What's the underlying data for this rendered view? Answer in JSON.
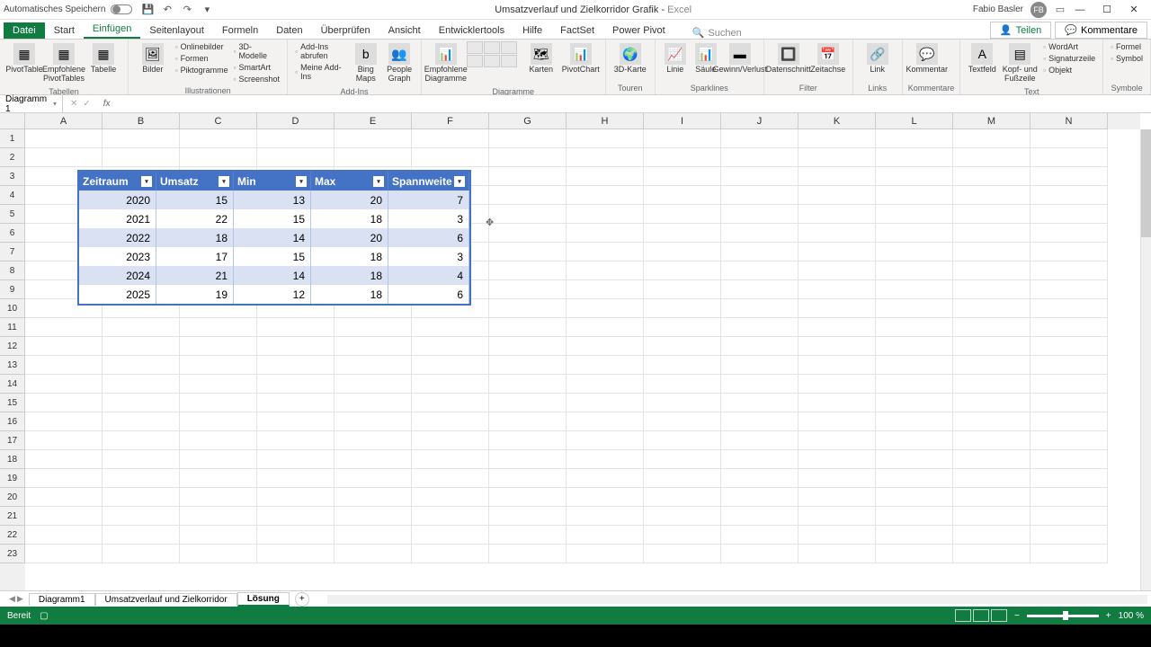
{
  "titlebar": {
    "autosave": "Automatisches Speichern",
    "doc_name": "Umsatzverlauf und Zielkorridor Grafik",
    "app_name": "Excel",
    "user": "Fabio Basler",
    "user_initials": "FB"
  },
  "tabs": {
    "file": "Datei",
    "items": [
      "Start",
      "Einfügen",
      "Seitenlayout",
      "Formeln",
      "Daten",
      "Überprüfen",
      "Ansicht",
      "Entwicklertools",
      "Hilfe",
      "FactSet",
      "Power Pivot"
    ],
    "active": "Einfügen",
    "search_placeholder": "Suchen",
    "share": "Teilen",
    "comments": "Kommentare"
  },
  "ribbon": {
    "groups": {
      "tabellen": {
        "label": "Tabellen",
        "pivot": "PivotTable",
        "empf": "Empfohlene PivotTables",
        "table": "Tabelle"
      },
      "illustrationen": {
        "label": "Illustrationen",
        "bilder": "Bilder",
        "online": "Onlinebilder",
        "formen": "Formen",
        "smartart": "SmartArt",
        "pikto": "Piktogramme",
        "model3d": "3D-Modelle",
        "screenshot": "Screenshot"
      },
      "addins": {
        "label": "Add-Ins",
        "abrufen": "Add-Ins abrufen",
        "meine": "Meine Add-Ins",
        "bing": "Bing Maps",
        "people": "People Graph"
      },
      "diagramme": {
        "label": "Diagramme",
        "empf": "Empfohlene Diagramme",
        "karten": "Karten",
        "pivot": "PivotChart"
      },
      "touren": {
        "label": "Touren",
        "karte3d": "3D-Karte"
      },
      "sparklines": {
        "label": "Sparklines",
        "linie": "Linie",
        "saule": "Säule",
        "gewinn": "Gewinn/Verlust"
      },
      "filter": {
        "label": "Filter",
        "daten": "Datenschnitt",
        "zeit": "Zeitachse"
      },
      "links": {
        "label": "Links",
        "link": "Link"
      },
      "kommentare": {
        "label": "Kommentare",
        "kommentar": "Kommentar"
      },
      "text": {
        "label": "Text",
        "textfeld": "Textfeld",
        "kopf": "Kopf- und Fußzeile",
        "wordart": "WordArt",
        "sig": "Signaturzeile",
        "objekt": "Objekt"
      },
      "symbole": {
        "label": "Symbole",
        "formel": "Formel",
        "symbol": "Symbol"
      }
    }
  },
  "namebox": "Diagramm 1",
  "columns": [
    "A",
    "B",
    "C",
    "D",
    "E",
    "F",
    "G",
    "H",
    "I",
    "J",
    "K",
    "L",
    "M",
    "N"
  ],
  "rows": [
    "1",
    "2",
    "3",
    "4",
    "5",
    "6",
    "7",
    "8",
    "9",
    "10",
    "11",
    "12",
    "13",
    "14",
    "15",
    "16",
    "17",
    "18",
    "19",
    "20",
    "21",
    "22",
    "23"
  ],
  "table": {
    "headers": [
      "Zeitraum",
      "Umsatz",
      "Min",
      "Max",
      "Spannweite"
    ],
    "data": [
      [
        "2020",
        "15",
        "13",
        "20",
        "7"
      ],
      [
        "2021",
        "22",
        "15",
        "18",
        "3"
      ],
      [
        "2022",
        "18",
        "14",
        "20",
        "6"
      ],
      [
        "2023",
        "17",
        "15",
        "18",
        "3"
      ],
      [
        "2024",
        "21",
        "14",
        "18",
        "4"
      ],
      [
        "2025",
        "19",
        "12",
        "18",
        "6"
      ]
    ]
  },
  "chart_data": {
    "type": "table",
    "title": "Umsatzverlauf und Zielkorridor",
    "categories": [
      "2020",
      "2021",
      "2022",
      "2023",
      "2024",
      "2025"
    ],
    "series": [
      {
        "name": "Umsatz",
        "values": [
          15,
          22,
          18,
          17,
          21,
          19
        ]
      },
      {
        "name": "Min",
        "values": [
          13,
          15,
          14,
          15,
          14,
          12
        ]
      },
      {
        "name": "Max",
        "values": [
          20,
          18,
          20,
          18,
          18,
          18
        ]
      },
      {
        "name": "Spannweite",
        "values": [
          7,
          3,
          6,
          3,
          4,
          6
        ]
      }
    ]
  },
  "sheets": {
    "items": [
      "Diagramm1",
      "Umsatzverlauf und Zielkorridor",
      "Lösung"
    ],
    "active": "Lösung"
  },
  "status": {
    "ready": "Bereit",
    "zoom": "100 %"
  }
}
